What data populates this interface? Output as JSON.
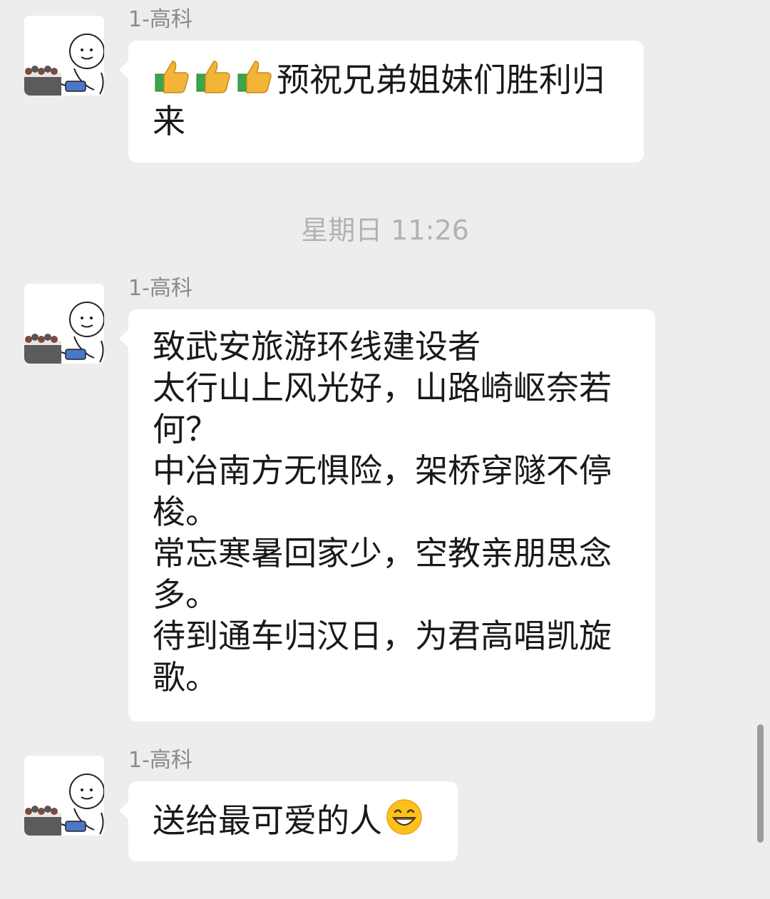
{
  "messages": [
    {
      "sender": "1-高科",
      "emoji": [
        "thumbs-up-icon",
        "thumbs-up-icon",
        "thumbs-up-icon"
      ],
      "lines": [
        "预祝兄弟姐妹们胜利归",
        "来"
      ]
    },
    {
      "sender": "1-高科",
      "lines": [
        "致武安旅游环线建设者",
        "太行山上风光好，山路崎岖奈若",
        "何？",
        "中冶南方无惧险，架桥穿隧不停",
        "梭。",
        "常忘寒暑回家少，空教亲朋思念",
        "多。",
        "待到通车归汉日，为君高唱凯旋",
        "歌。"
      ]
    },
    {
      "sender": "1-高科",
      "lines": [
        "送给最可爱的人"
      ],
      "trailing_emoji": "grinning-face-icon"
    }
  ],
  "timestamp": "星期日 11:26",
  "colors": {
    "background": "#ededed",
    "bubble": "#ffffff",
    "text": "#191919",
    "sender": "#8a8a8a",
    "timestamp": "#b2b2b2"
  }
}
